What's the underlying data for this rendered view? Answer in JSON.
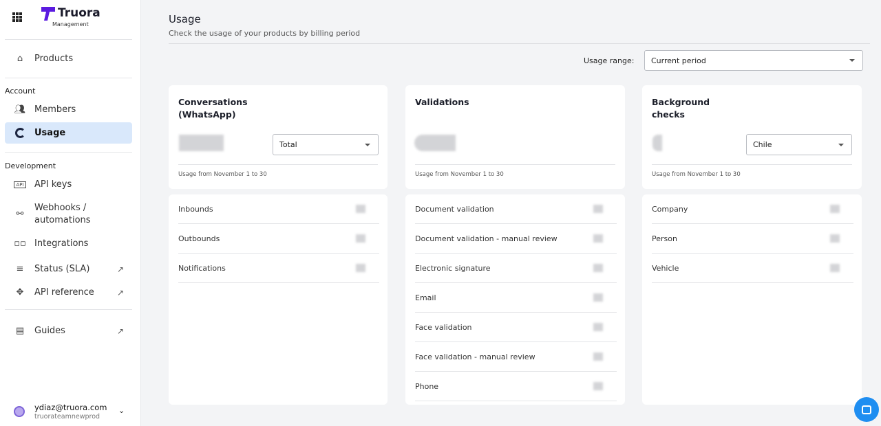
{
  "sidebar": {
    "brand": "Truora",
    "brand_sub": "Management",
    "products": "Products",
    "account_section": "Account",
    "members": "Members",
    "usage": "Usage",
    "dev_section": "Development",
    "api_keys": "API keys",
    "webhooks": "Webhooks / automations",
    "integrations": "Integrations",
    "status": "Status (SLA)",
    "api_reference": "API reference",
    "guides": "Guides",
    "user": {
      "email": "ydiaz@truora.com",
      "org": "truorateamnewprod"
    }
  },
  "header": {
    "title": "Usage",
    "subtitle": "Check the usage of your products by billing period"
  },
  "range": {
    "label": "Usage range:",
    "value": "Current period"
  },
  "cards": [
    {
      "title": "Conversations (WhatsApp)",
      "filter": "Total",
      "note": "Usage from November 1 to 30",
      "rows": [
        "Inbounds",
        "Outbounds",
        "Notifications"
      ]
    },
    {
      "title": "Validations",
      "note": "Usage from November 1 to 30",
      "rows": [
        "Document validation",
        "Document validation - manual review",
        "Electronic signature",
        "Email",
        "Face validation",
        "Face validation - manual review",
        "Phone"
      ]
    },
    {
      "title": "Background checks",
      "filter": "Chile",
      "note": "Usage from November 1 to 30",
      "rows": [
        "Company",
        "Person",
        "Vehicle"
      ]
    }
  ],
  "colors": {
    "accent": "#5b1be0",
    "active_bg": "#d9e8fb",
    "chat": "#1f8ef1"
  }
}
